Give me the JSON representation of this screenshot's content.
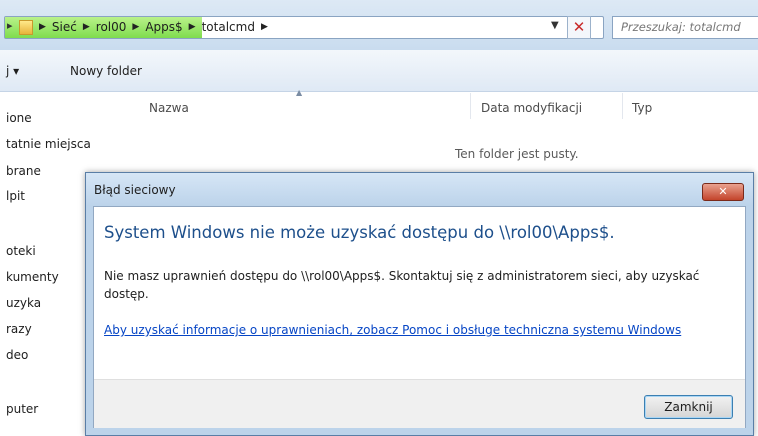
{
  "address_bar": {
    "crumbs": [
      "Sieć",
      "rol00",
      "Apps$",
      "totalcmd"
    ],
    "search_placeholder": "Przeszukaj: totalcmd",
    "close_glyph": "✕",
    "progress_fraction": 0.33
  },
  "toolbar": {
    "left_item": "j ▾",
    "new_folder": "Nowy folder"
  },
  "nav": {
    "items": [
      "ione",
      "tatnie miejsca",
      "brane",
      "lpit",
      "oteki",
      "kumenty",
      "uzyka",
      "razy",
      "deo",
      "puter"
    ]
  },
  "columns": {
    "name": "Nazwa",
    "date": "Data modyfikacji",
    "type": "Typ"
  },
  "empty_text": "Ten folder jest pusty.",
  "dialog": {
    "title": "Błąd sieciowy",
    "heading": "System Windows nie może uzyskać dostępu do \\\\rol00\\Apps$.",
    "message": "Nie masz uprawnień dostępu do \\\\rol00\\Apps$. Skontaktuj się z administratorem sieci, aby uzyskać dostęp.",
    "link": "Aby uzyskać informacje o uprawnieniach, zobacz Pomoc i obsługe techniczna systemu Windows",
    "close_label": "Zamknij",
    "close_glyph": "✕"
  },
  "colors": {
    "heading_blue": "#1d4f8b",
    "link_blue": "#0645c5",
    "progress_green": "#7fdc4e",
    "close_red": "#c3442b"
  }
}
